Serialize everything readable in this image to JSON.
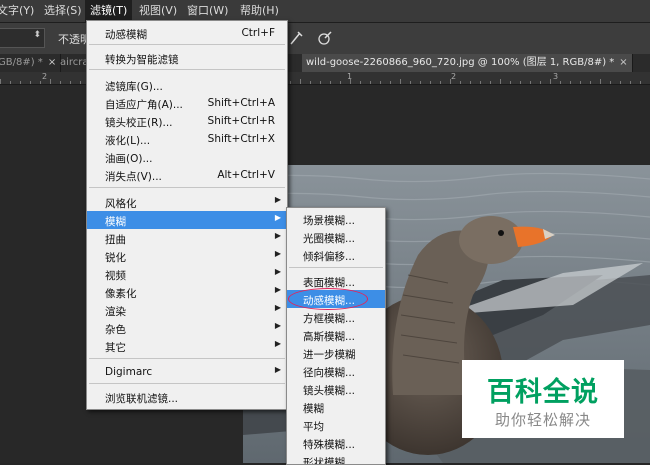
{
  "menubar": {
    "items": [
      "文字(Y)",
      "选择(S)",
      "滤镜(T)",
      "视图(V)",
      "窗口(W)",
      "帮助(H)"
    ]
  },
  "options": {
    "opacity_label": "不透明"
  },
  "tabs": [
    {
      "label": "GB/8#) *"
    },
    {
      "label": "aircra"
    },
    {
      "label": "wild-goose-2260866_960_720.jpg @ 100% (图层 1, RGB/8#) *"
    }
  ],
  "ruler": {
    "labels": [
      "2",
      "1",
      "2",
      "3"
    ]
  },
  "filter_menu": {
    "items": [
      {
        "label": "动感模糊",
        "shortcut": "Ctrl+F"
      },
      {
        "label": "转换为智能滤镜"
      },
      {
        "label": "滤镜库(G)..."
      },
      {
        "label": "自适应广角(A)...",
        "shortcut": "Shift+Ctrl+A"
      },
      {
        "label": "镜头校正(R)...",
        "shortcut": "Shift+Ctrl+R"
      },
      {
        "label": "液化(L)...",
        "shortcut": "Shift+Ctrl+X"
      },
      {
        "label": "油画(O)..."
      },
      {
        "label": "消失点(V)...",
        "shortcut": "Alt+Ctrl+V"
      },
      {
        "label": "风格化"
      },
      {
        "label": "模糊"
      },
      {
        "label": "扭曲"
      },
      {
        "label": "锐化"
      },
      {
        "label": "视频"
      },
      {
        "label": "像素化"
      },
      {
        "label": "渲染"
      },
      {
        "label": "杂色"
      },
      {
        "label": "其它"
      },
      {
        "label": "Digimarc"
      },
      {
        "label": "浏览联机滤镜..."
      }
    ]
  },
  "blur_menu": {
    "items": [
      "场景模糊...",
      "光圈模糊...",
      "倾斜偏移...",
      "表面模糊...",
      "动感模糊...",
      "方框模糊...",
      "高斯模糊...",
      "进一步模糊",
      "径向模糊...",
      "镜头模糊...",
      "模糊",
      "平均",
      "特殊模糊...",
      "形状模糊..."
    ]
  },
  "watermark": {
    "title": "百科全说",
    "subtitle": "助你轻松解决"
  },
  "colors": {
    "highlight": "#3d8ee6",
    "annotation": "#e2245a",
    "watermark_green": "#00a060"
  }
}
